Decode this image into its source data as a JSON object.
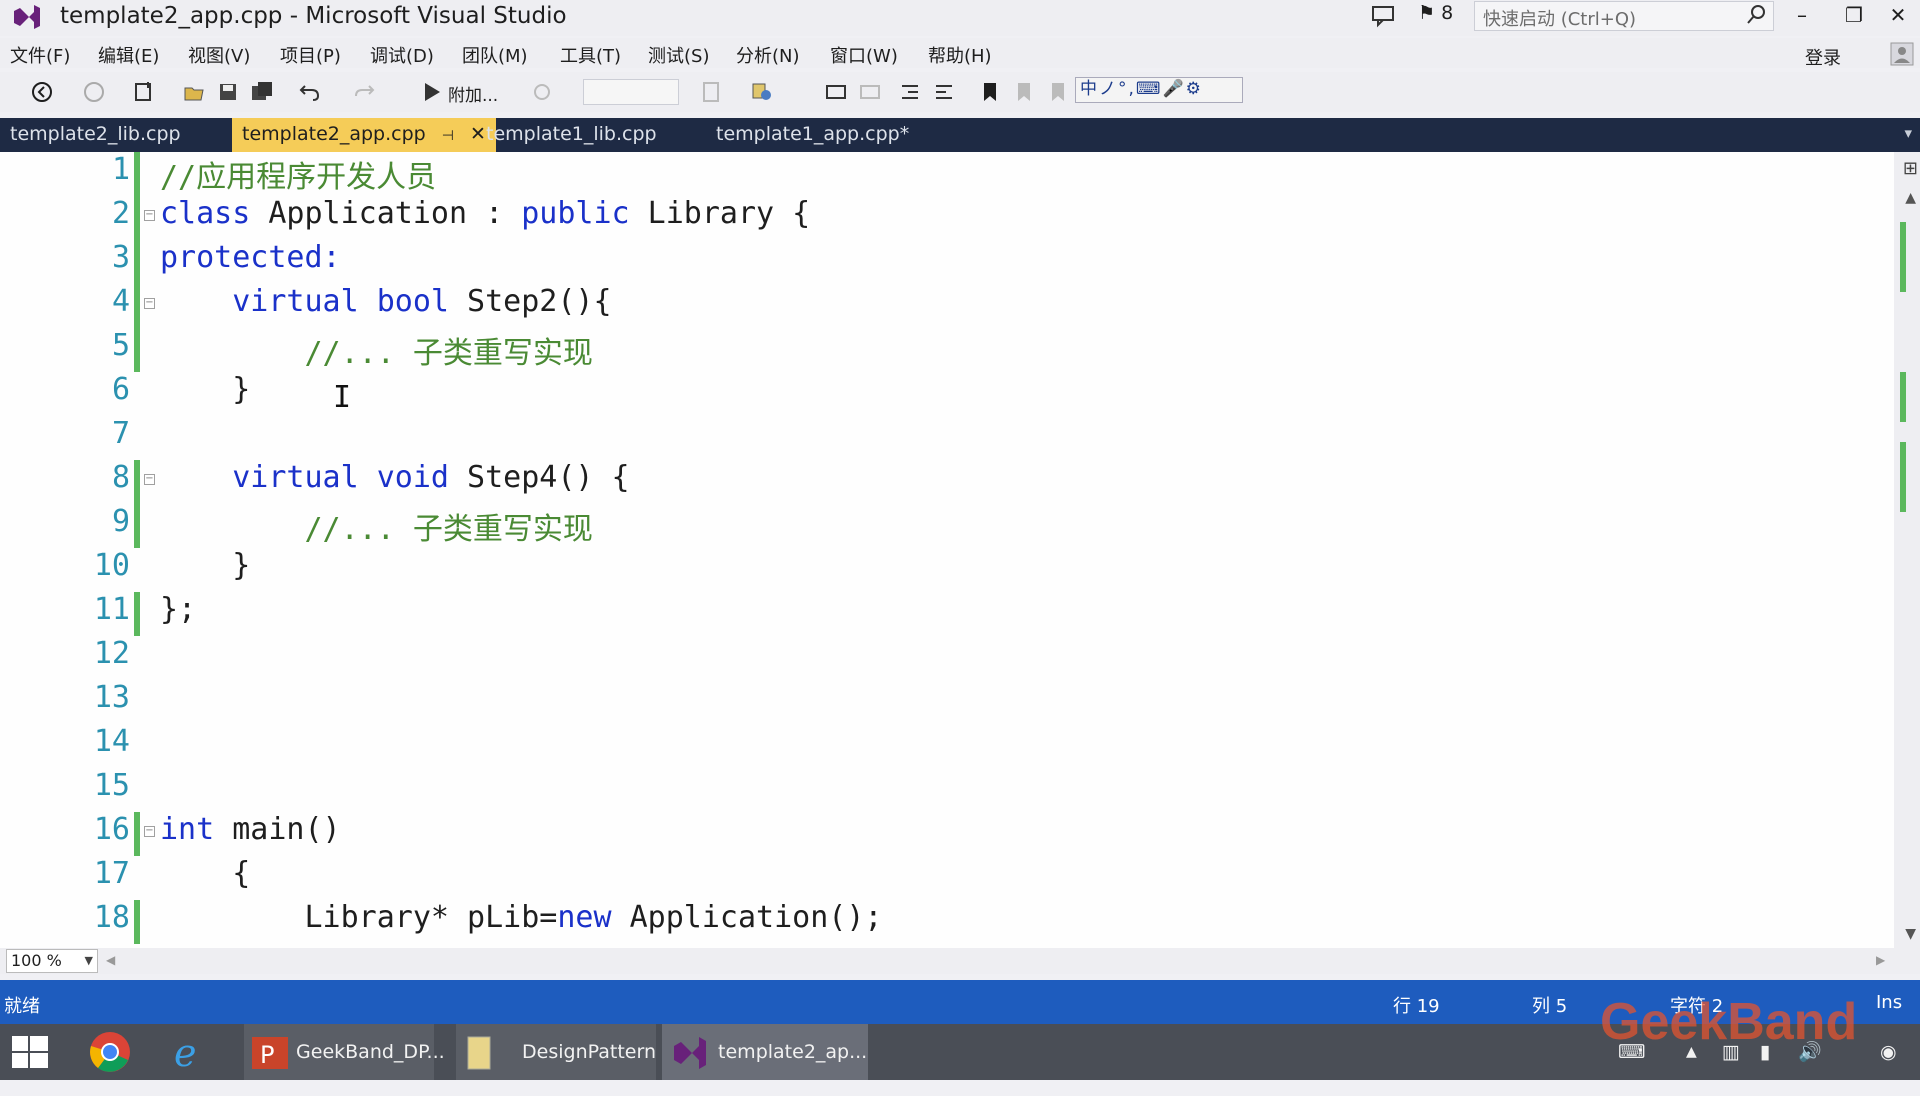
{
  "window": {
    "title": "template2_app.cpp - Microsoft Visual Studio",
    "notification_count": "8",
    "quick_launch_placeholder": "快速启动 (Ctrl+Q)",
    "login": "登录"
  },
  "menu": [
    "文件(F)",
    "编辑(E)",
    "视图(V)",
    "项目(P)",
    "调试(D)",
    "团队(M)",
    "工具(T)",
    "测试(S)",
    "分析(N)",
    "窗口(W)",
    "帮助(H)"
  ],
  "toolbar": {
    "attach_label": "附加...",
    "ime_text": "中ノ°,⌨🎤⚙"
  },
  "tabs": {
    "tab1": "template2_lib.cpp",
    "active": "template2_app.cpp",
    "tab3": "template1_lib.cpp",
    "tab4": "template1_app.cpp*"
  },
  "editor": {
    "lines": [
      {
        "n": "1",
        "text": "//应用程序开发人员"
      },
      {
        "n": "2",
        "text": "class Application : public Library {"
      },
      {
        "n": "3",
        "text": "protected:"
      },
      {
        "n": "4",
        "text": "    virtual bool Step2(){"
      },
      {
        "n": "5",
        "text": "        //... 子类重写实现"
      },
      {
        "n": "6",
        "text": "    }"
      },
      {
        "n": "7",
        "text": ""
      },
      {
        "n": "8",
        "text": "    virtual void Step4() {"
      },
      {
        "n": "9",
        "text": "        //... 子类重写实现"
      },
      {
        "n": "10",
        "text": "    }"
      },
      {
        "n": "11",
        "text": "};"
      },
      {
        "n": "12",
        "text": ""
      },
      {
        "n": "13",
        "text": ""
      },
      {
        "n": "14",
        "text": ""
      },
      {
        "n": "15",
        "text": ""
      },
      {
        "n": "16",
        "text": "int main()"
      },
      {
        "n": "17",
        "text": "    {"
      },
      {
        "n": "18",
        "text": "        Library* pLib=new Application();"
      }
    ],
    "zoom": "100 %"
  },
  "status": {
    "state": "就绪",
    "row": "行 19",
    "col": "列 5",
    "char": "字符 2",
    "mode": "Ins"
  },
  "taskbar": {
    "ppt": "GeekBand_DP...",
    "folder": "DesignPattern",
    "vs": "template2_ap..."
  },
  "watermark": "GeekBand",
  "colors": {
    "accent_status": "#1e5cbe",
    "tab_active": "#f5cc58",
    "keyword": "#1a31c9",
    "comment": "#4a8a34",
    "line_number": "#2b91af",
    "change_marker": "#5bb85d"
  }
}
